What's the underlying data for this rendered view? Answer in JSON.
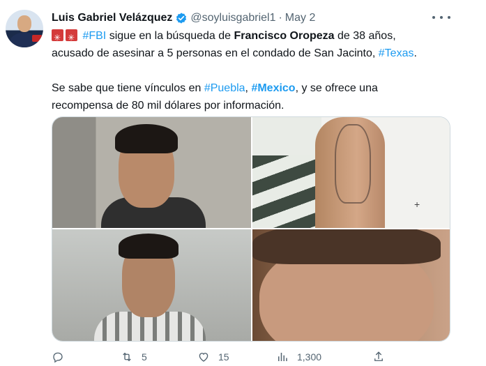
{
  "author": {
    "name": "Luis Gabriel Velázquez",
    "handle": "@soyluisgabriel1",
    "separator": "·",
    "date": "May 2",
    "verified_color": "#1d9bf0"
  },
  "tweet": {
    "line1": {
      "hashtag_fbi": "#FBI",
      "t1": " sigue en la búsqueda de ",
      "name_bold": "Francisco Oropeza",
      "t2": " de 38 años,"
    },
    "line2": {
      "t1": "acusado de asesinar a 5 personas en el condado de San Jacinto, ",
      "hashtag_texas": "#Texas",
      "t2": "."
    },
    "line3": {
      "t1": "Se sabe que tiene vínculos en ",
      "hashtag_puebla": "#Puebla",
      "t2": ", ",
      "hashtag_mexico": "#Mexico",
      "t3": ", y se ofrece una"
    },
    "line4": "recompensa de 80 mil dólares por información."
  },
  "actions": {
    "reply_count": "",
    "retweet_count": "5",
    "like_count": "15",
    "views_count": "1,300"
  },
  "colors": {
    "link": "#1d9bf0",
    "muted": "#536471",
    "text": "#0f1419"
  },
  "icons": [
    "verified-badge-icon",
    "more-icon",
    "siren-emoji",
    "reply-icon",
    "retweet-icon",
    "like-icon",
    "views-icon",
    "share-icon"
  ]
}
